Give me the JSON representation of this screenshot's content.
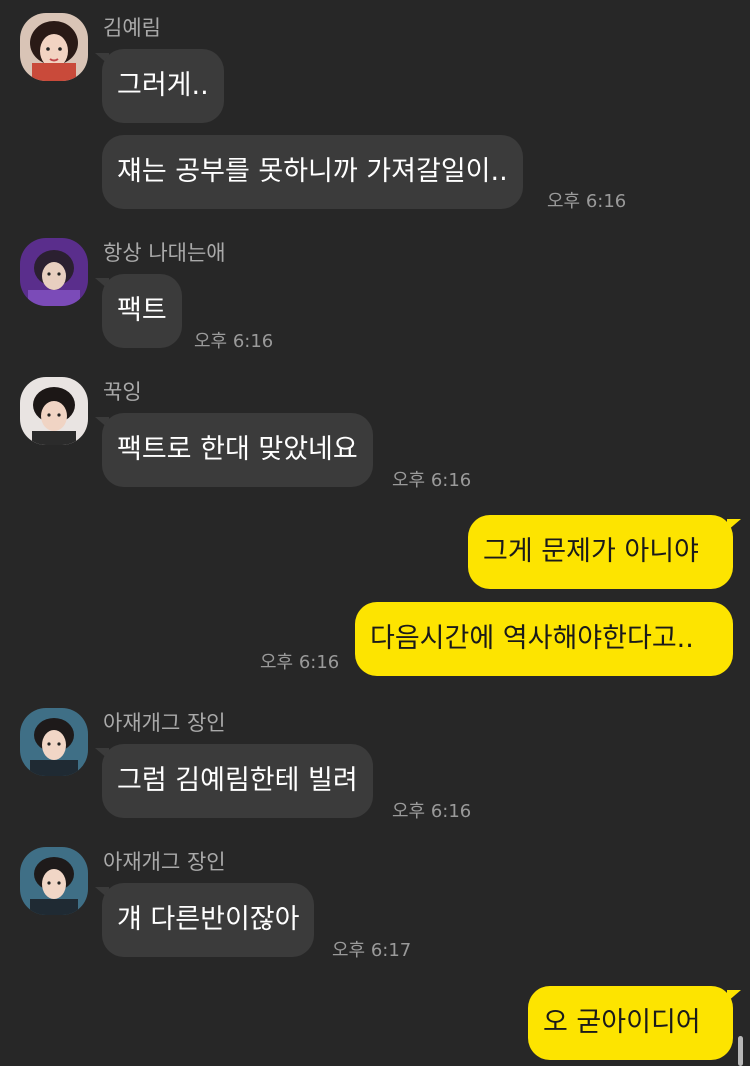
{
  "messages": [
    {
      "sender": "김예림",
      "texts": [
        "그러게..",
        "쟤는 공부를 못하니까 가져갈일이.."
      ],
      "time": "오후 6:16"
    },
    {
      "sender": "항상 나대는애",
      "texts": [
        "팩트"
      ],
      "time": "오후 6:16"
    },
    {
      "sender": "꾹잉",
      "texts": [
        "팩트로 한대 맞았네요"
      ],
      "time": "오후 6:16"
    },
    {
      "sender": "me",
      "texts": [
        "그게 문제가 아니야",
        "다음시간에 역사해야한다고.."
      ],
      "time": "오후 6:16"
    },
    {
      "sender": "아재개그 장인",
      "texts": [
        "그럼 김예림한테 빌려"
      ],
      "time": "오후 6:16"
    },
    {
      "sender": "아재개그 장인",
      "texts": [
        "걔 다른반이잖아"
      ],
      "time": "오후 6:17"
    },
    {
      "sender": "me",
      "texts": [
        "오 굳아이디어"
      ],
      "time": ""
    }
  ],
  "colors": {
    "background": "#272727",
    "incoming_bubble": "#3b3b3b",
    "outgoing_bubble": "#fde400"
  },
  "icons": {
    "avatar": "profile-photo"
  }
}
